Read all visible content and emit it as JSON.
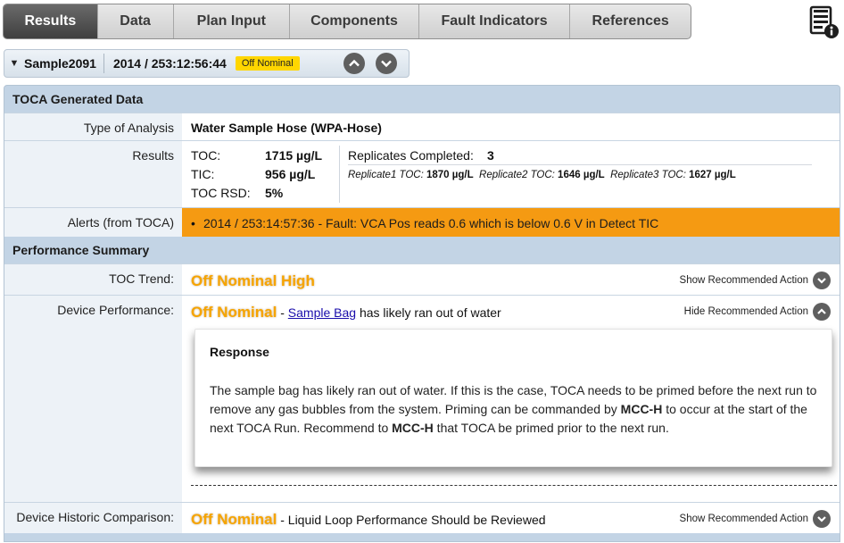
{
  "tabs": [
    "Results",
    "Data",
    "Plan Input",
    "Components",
    "Fault Indicators",
    "References"
  ],
  "active_tab": "Results",
  "sample": {
    "name": "Sample2091",
    "time": "2014 / 253:12:56:44",
    "status": "Off Nominal",
    "status_color": "#ffd600"
  },
  "toca": {
    "section_title": "TOCA Generated Data",
    "type_label": "Type of Analysis",
    "type_value": "Water Sample Hose (WPA-Hose)",
    "results_label": "Results",
    "toc_label": "TOC:",
    "toc_value": "1715 µg/L",
    "tic_label": "TIC:",
    "tic_value": "956 µg/L",
    "rsd_label": "TOC RSD:",
    "rsd_value": "5%",
    "rep_label": "Replicates Completed:",
    "rep_value": "3",
    "rep1_label": "Replicate1 TOC:",
    "rep1_value": "1870 µg/L",
    "rep2_label": "Replicate2 TOC:",
    "rep2_value": "1646 µg/L",
    "rep3_label": "Replicate3 TOC:",
    "rep3_value": "1627 µg/L",
    "alerts_label": "Alerts (from TOCA)",
    "alert_text": "2014 / 253:14:57:36 - Fault: VCA Pos reads 0.6 which is below 0.6 V in Detect TIC",
    "alert_color": "#f59a12"
  },
  "performance": {
    "section_title": "Performance Summary",
    "trend_label": "TOC Trend:",
    "trend_status": "Off Nominal High",
    "trend_action": "Show Recommended Action",
    "device_label": "Device Performance:",
    "device_status": "Off Nominal",
    "device_dash": " - ",
    "device_link": "Sample Bag",
    "device_text": " has likely ran out of water",
    "device_action": "Hide Recommended Action",
    "response_title": "Response",
    "response_1": "The sample bag has likely ran out of water. If this is the case, TOCA needs to be primed before the next run to remove any gas bubbles from the system. Priming can be commanded by ",
    "response_b1": "MCC-H",
    "response_2": " to occur at the start of the next TOCA Run. Recommend to ",
    "response_b2": "MCC-H",
    "response_3": " that TOCA be primed prior to the next run.",
    "historic_label": "Device Historic Comparison:",
    "historic_status": "Off Nominal",
    "historic_text": " - Liquid Loop Performance Should be Reviewed",
    "historic_action": "Show Recommended Action",
    "status_color": "#f6a400"
  },
  "icons": [
    "report-info-icon",
    "chevron-up-icon",
    "chevron-down-icon",
    "caret-down-icon"
  ]
}
